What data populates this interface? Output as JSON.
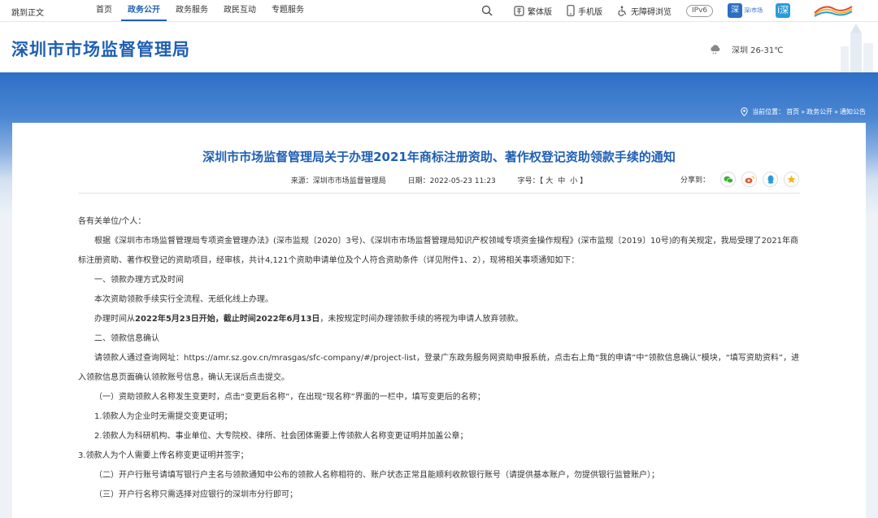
{
  "topbar": {
    "skip_label": "跳到正文",
    "nav": [
      "首页",
      "政务公开",
      "政务服务",
      "政民互动",
      "专题服务"
    ],
    "active_index": 1,
    "tools": {
      "traditional": "繁体版",
      "mobile": "手机版",
      "accessible": "无障碍浏览",
      "ipv6": "IPv6",
      "app_char": "深",
      "app_text": "深i市场",
      "green_char": "i深"
    }
  },
  "header": {
    "site_title": "深圳市市场监督管理局",
    "weather": "深圳 26-31℃"
  },
  "breadcrumb": {
    "prefix": "当前位置：",
    "items": [
      "首页",
      "政务公开",
      "通知公告"
    ],
    "sep": " » "
  },
  "article": {
    "title": "深圳市市场监督管理局关于办理2021年商标注册资助、著作权登记资助领款手续的通知",
    "source_label": "来源：",
    "source": "深圳市市场监督管理局",
    "date_label": "日期：",
    "date": "2022-05-23 11:23",
    "font_label": "字号：",
    "font_open": "【",
    "font_sizes": [
      "大",
      "中",
      "小"
    ],
    "font_close": "】",
    "share_label": "分享到：",
    "paragraphs": {
      "p1": "各有关单位/个人：",
      "p2": "根据《深圳市市场监督管理局专项资金管理办法》(深市监规〔2020〕3号)、《深圳市市场监督管理局知识产权领域专项资金操作规程》(深市监规〔2019〕10号)的有关规定，我局受理了2021年商标注册资助、著作权登记的资助项目，经审核，共计4,121个资助申请单位及个人符合资助条件（详见附件1、2），现将相关事项通知如下：",
      "p3": "一、领款办理方式及时间",
      "p4": "本次资助领款手续实行全流程、无纸化线上办理。",
      "p5a": "办理时间从",
      "p5b": "2022年5月23日开始，截止时间2022年6月13日",
      "p5c": "，未按规定时间办理领款手续的将视为申请人放弃领款。",
      "p6": "二、领款信息确认",
      "p7": "请领款人通过查询网址：https://amr.sz.gov.cn/mrasgas/sfc-company/#/project-list，登录广东政务服务网资助申报系统，点击右上角“我的申请”中“领款信息确认”模块，“填写资助资料”，进入领款信息页面确认领款账号信息，确认无误后点击提交。",
      "p8": "（一）资助领款人名称发生变更时，点击“变更后名称”，在出现“现名称”界面的一栏中，填写变更后的名称；",
      "p9": "1.领款人为企业时无需提交变更证明；",
      "p10": "2.领款人为科研机构、事业单位、大专院校、律所、社会团体需要上传领款人名称变更证明并加盖公章；",
      "p11": "3.领款人为个人需要上传名称变更证明并签字；",
      "p12": "（二）开户行账号请填写银行户主名与领款通知中公布的领款人名称相符的、账户状态正常且能顺利收款银行账号（请提供基本账户，勿提供银行监管账户）；",
      "p13": "（三）开户行名称只需选择对应银行的深圳市分行即可；"
    }
  },
  "colors": {
    "brand_blue": "#1f5fb4",
    "wechat_green": "#3cb034",
    "weibo_red": "#e6562d",
    "qq_blue": "#2a9bd9",
    "qzone_yellow": "#f2b61e"
  }
}
